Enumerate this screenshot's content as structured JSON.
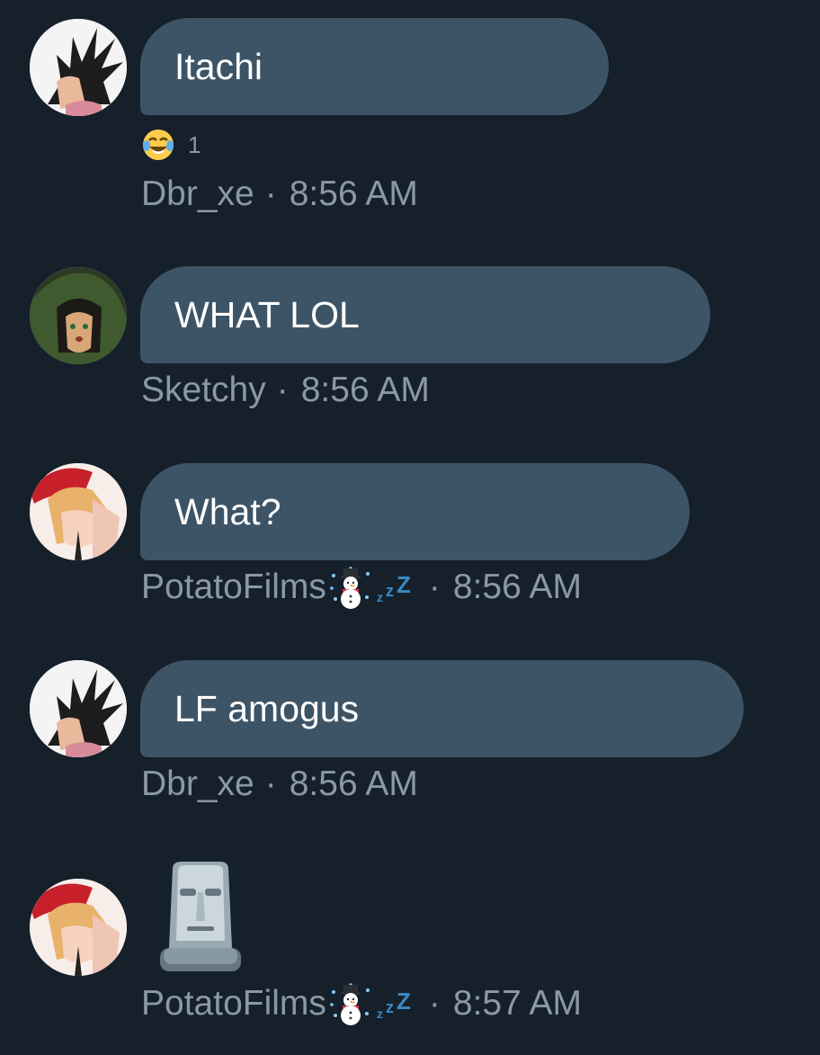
{
  "messages": [
    {
      "text": "Itachi",
      "reaction": {
        "emoji_icon": "face-with-tears-of-joy-icon",
        "count": "1"
      },
      "author": "Dbr_xe",
      "separator": "·",
      "time": "8:56 AM"
    },
    {
      "text": "WHAT LOL",
      "author": "Sketchy",
      "separator": "·",
      "time": "8:56 AM"
    },
    {
      "text": "What?",
      "author": "PotatoFilms",
      "author_badges": [
        "snowman-icon",
        "zzz-sleeping-icon"
      ],
      "separator": "·",
      "time": "8:56 AM"
    },
    {
      "text": "LF amogus",
      "author": "Dbr_xe",
      "separator": "·",
      "time": "8:56 AM"
    },
    {
      "emoji_icon": "moai-icon",
      "author": "PotatoFilms",
      "author_badges": [
        "snowman-icon",
        "zzz-sleeping-icon"
      ],
      "separator": "·",
      "time": "8:57 AM"
    }
  ],
  "colors": {
    "background": "#15202b",
    "bubble": "#3d5466",
    "bubble_text": "#ffffff",
    "meta_text": "#8b98a5",
    "zzz": "#3b88c3"
  }
}
